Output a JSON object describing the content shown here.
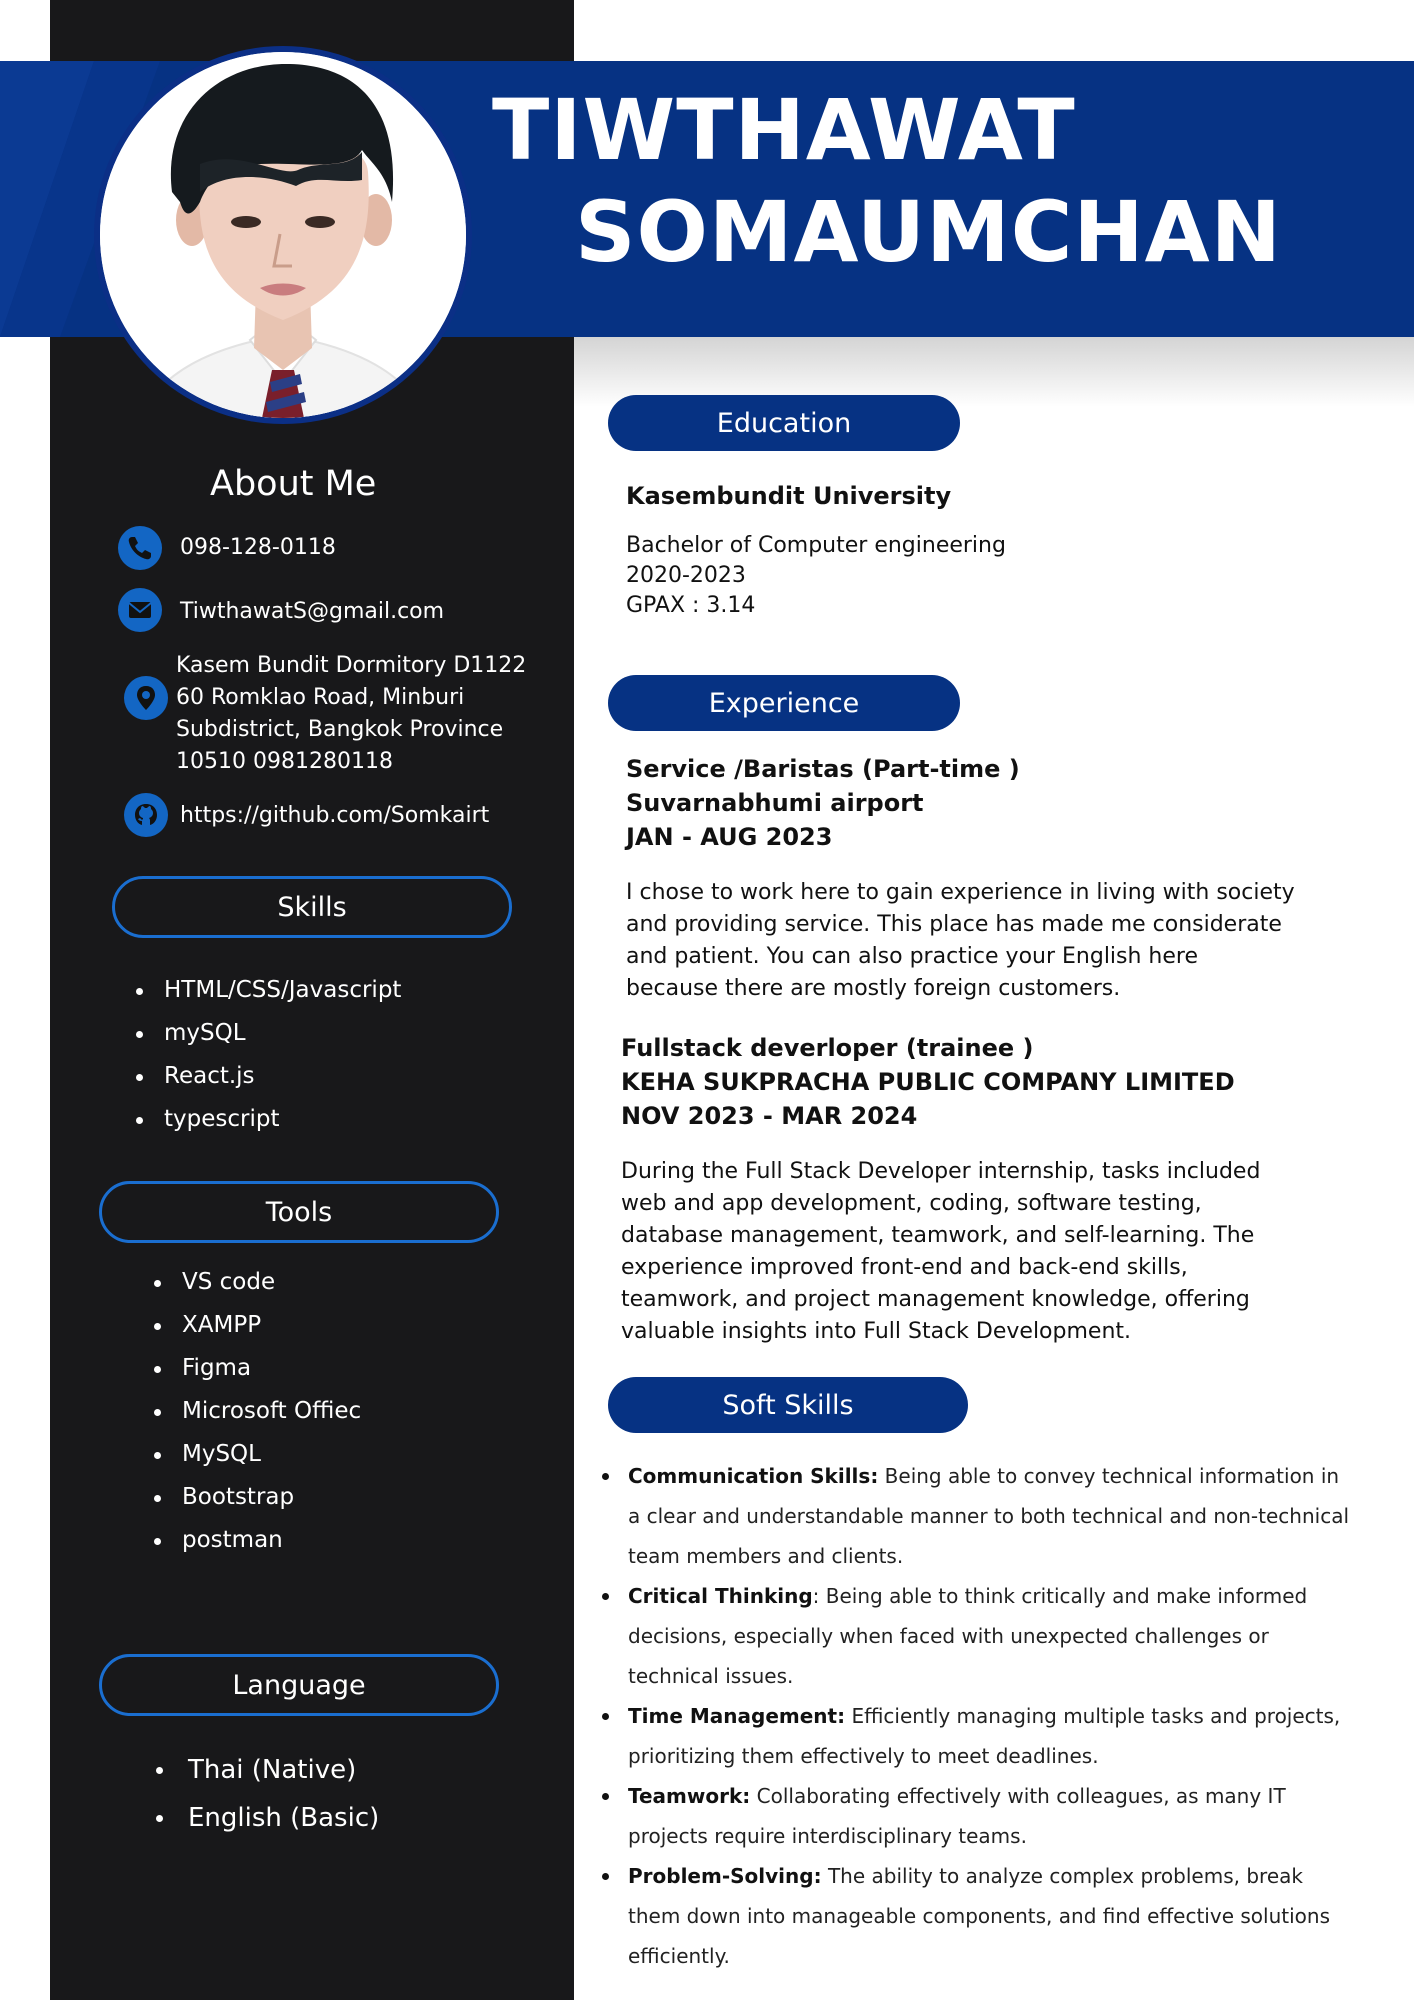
{
  "name": {
    "first": "TIWTHAWAT",
    "last": "SOMAUMCHAN"
  },
  "colors": {
    "navy": "#063283",
    "sidebar": "#18181a",
    "accent_blue": "#1366c4"
  },
  "photo": {
    "icon": "portrait-photo"
  },
  "about": {
    "title": "About Me",
    "phone": "098-128-0118",
    "email": "TiwthawatS@gmail.com",
    "address_lines": [
      "Kasem Bundit Dormitory D1122",
      "60 Romklao Road, Minburi",
      "Subdistrict, Bangkok Province",
      "10510 0981280118"
    ],
    "github": "https://github.com/Somkairt",
    "icons": [
      "phone-icon",
      "mail-icon",
      "location-pin-icon",
      "github-icon"
    ]
  },
  "skills": {
    "title": "Skills",
    "items": [
      "HTML/CSS/Javascript",
      "mySQL",
      "React.js",
      "typescript"
    ]
  },
  "tools": {
    "title": "Tools",
    "items": [
      "VS code",
      "XAMPP",
      "Figma",
      "Microsoft Offiec",
      "MySQL",
      "Bootstrap",
      "postman"
    ]
  },
  "language": {
    "title": "Language",
    "items": [
      "Thai (Native)",
      "English (Basic)"
    ]
  },
  "education": {
    "title": "Education",
    "school": "Kasembundit University",
    "degree": "Bachelor of Computer engineering",
    "years": "2020-2023",
    "gpax": "GPAX : 3.14"
  },
  "experience": {
    "title": "Experience",
    "jobs": [
      {
        "role": "Service /Baristas (Part-time )",
        "company": "Suvarnabhumi airport",
        "period": "JAN - AUG 2023",
        "desc_lines": [
          "I chose to work here to gain experience in living with society",
          "and providing service. This place has made me considerate",
          "and patient. You can also practice your English here",
          "because there are mostly foreign customers."
        ]
      },
      {
        "role": "Fullstack deverloper (trainee )",
        "company": "KEHA SUKPRACHA PUBLIC COMPANY LIMITED",
        "period": "NOV 2023 - MAR 2024",
        "desc_lines": [
          "During the Full Stack Developer internship, tasks included",
          "web and app development, coding, software testing,",
          "database management, teamwork, and self-learning. The",
          "experience improved front-end and back-end skills,",
          "teamwork, and project management knowledge, offering",
          "valuable insights into Full Stack Development."
        ]
      }
    ]
  },
  "soft_skills": {
    "title": "Soft Skills",
    "items": [
      {
        "label": "Communication Skills:",
        "text": " Being able to convey technical information in a clear and understandable manner to both technical and non-technical team members and clients."
      },
      {
        "label": "Critical Thinking",
        "text": ": Being able to think critically and make informed decisions, especially when faced with unexpected challenges or technical issues."
      },
      {
        "label": "Time Management:",
        "text": " Efficiently managing multiple tasks and projects, prioritizing them effectively to meet deadlines."
      },
      {
        "label": "Teamwork:",
        "text": " Collaborating effectively with colleagues, as many IT projects require interdisciplinary teams."
      },
      {
        "label": "Problem-Solving:",
        "text": " The ability to analyze complex problems, break them down into manageable components, and find effective solutions efficiently."
      }
    ]
  }
}
